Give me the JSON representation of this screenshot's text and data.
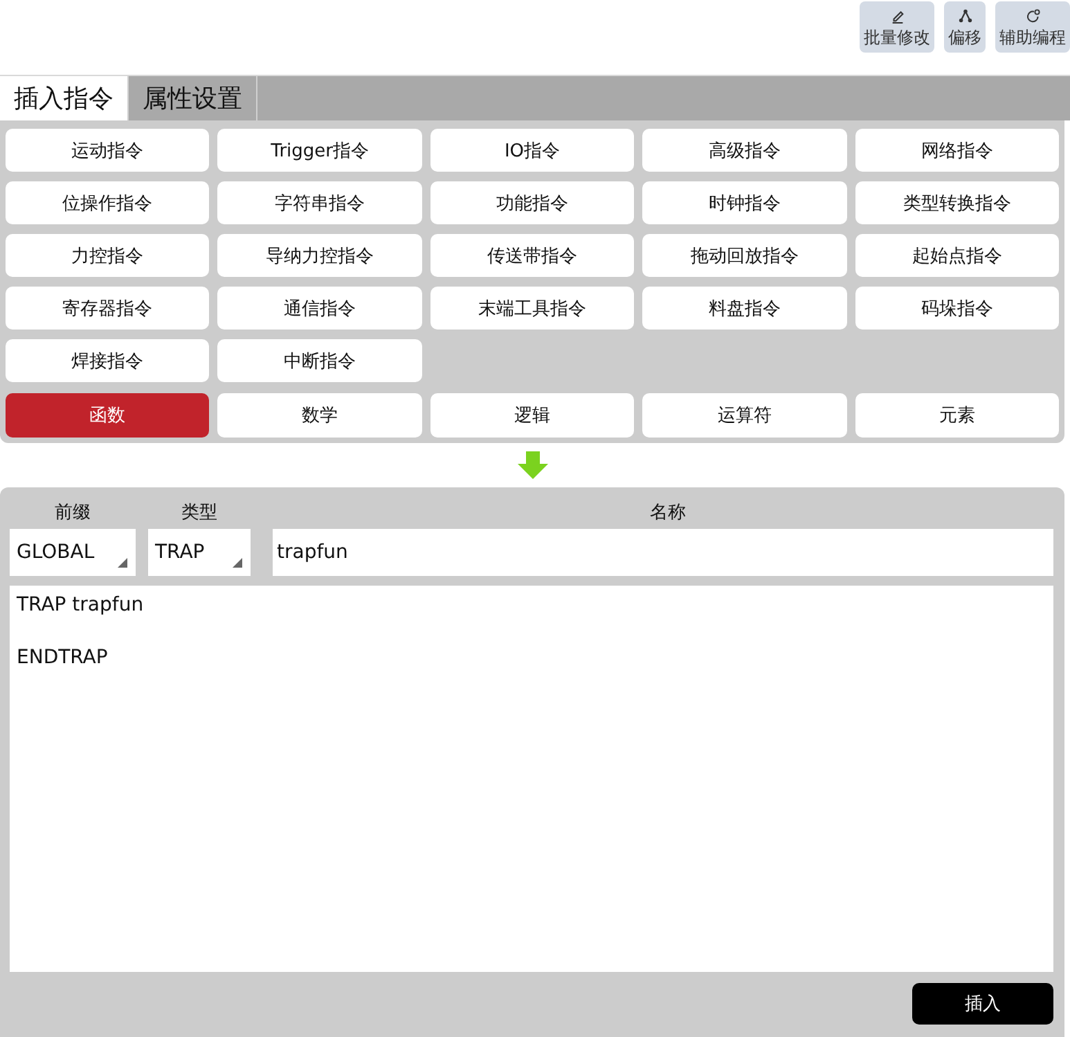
{
  "toolbar": [
    {
      "label": "批量修改"
    },
    {
      "label": "偏移"
    },
    {
      "label": "辅助编程"
    }
  ],
  "tabs": [
    {
      "label": "插入指令",
      "selected": true
    },
    {
      "label": "属性设置",
      "selected": false
    }
  ],
  "instruction_groups": [
    {
      "label": "运动指令"
    },
    {
      "label": "Trigger指令"
    },
    {
      "label": "IO指令"
    },
    {
      "label": "高级指令"
    },
    {
      "label": "网络指令"
    },
    {
      "label": "位操作指令"
    },
    {
      "label": "字符串指令"
    },
    {
      "label": "功能指令"
    },
    {
      "label": "时钟指令"
    },
    {
      "label": "类型转换指令"
    },
    {
      "label": "力控指令"
    },
    {
      "label": "导纳力控指令"
    },
    {
      "label": "传送带指令"
    },
    {
      "label": "拖动回放指令"
    },
    {
      "label": "起始点指令"
    },
    {
      "label": "寄存器指令"
    },
    {
      "label": "通信指令"
    },
    {
      "label": "末端工具指令"
    },
    {
      "label": "料盘指令"
    },
    {
      "label": "码垛指令"
    },
    {
      "label": "焊接指令"
    },
    {
      "label": "中断指令"
    }
  ],
  "categories": [
    {
      "label": "函数",
      "selected": true
    },
    {
      "label": "数学",
      "selected": false
    },
    {
      "label": "逻辑",
      "selected": false
    },
    {
      "label": "运算符",
      "selected": false
    },
    {
      "label": "元素",
      "selected": false
    }
  ],
  "form": {
    "prefix": {
      "label": "前缀",
      "value": "GLOBAL"
    },
    "type": {
      "label": "类型",
      "value": "TRAP"
    },
    "name": {
      "label": "名称",
      "value": "trapfun"
    }
  },
  "code": "TRAP trapfun\n\nENDTRAP",
  "insert_button": "插入"
}
